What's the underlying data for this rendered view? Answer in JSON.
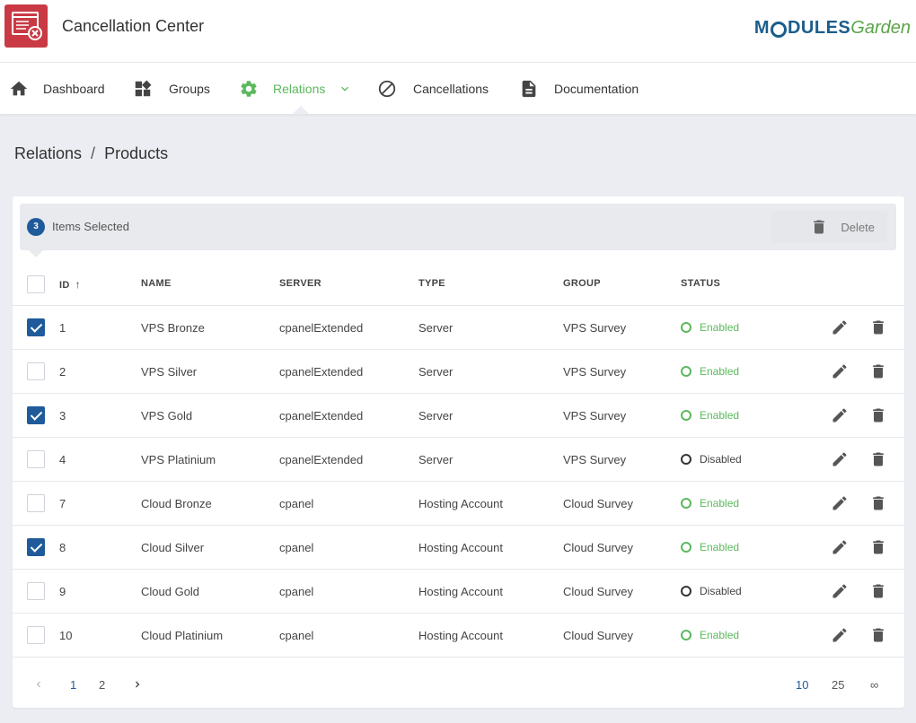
{
  "header": {
    "title": "Cancellation Center",
    "brand_left": "M",
    "brand_mid": "DULES",
    "brand_right": "Garden",
    "accent_color": "#c93a45"
  },
  "nav": {
    "items": [
      {
        "label": "Dashboard",
        "icon": "home-icon"
      },
      {
        "label": "Groups",
        "icon": "widgets-icon"
      },
      {
        "label": "Relations",
        "icon": "gear-icon",
        "active": true
      },
      {
        "label": "Cancellations",
        "icon": "block-icon"
      },
      {
        "label": "Documentation",
        "icon": "document-icon"
      }
    ],
    "active_color": "#5cb85c"
  },
  "breadcrumb": {
    "parent": "Relations",
    "separator": "/",
    "current": "Products"
  },
  "selection": {
    "count": "3",
    "label": "Items Selected",
    "delete_label": "Delete"
  },
  "table": {
    "columns": [
      "ID",
      "NAME",
      "SERVER",
      "TYPE",
      "GROUP",
      "STATUS"
    ],
    "sort_indicator": "↑",
    "rows": [
      {
        "checked": true,
        "id": "1",
        "name": "VPS Bronze",
        "server": "cpanelExtended",
        "type": "Server",
        "group": "VPS Survey",
        "status": "Enabled"
      },
      {
        "checked": false,
        "id": "2",
        "name": "VPS Silver",
        "server": "cpanelExtended",
        "type": "Server",
        "group": "VPS Survey",
        "status": "Enabled"
      },
      {
        "checked": true,
        "id": "3",
        "name": "VPS Gold",
        "server": "cpanelExtended",
        "type": "Server",
        "group": "VPS Survey",
        "status": "Enabled"
      },
      {
        "checked": false,
        "id": "4",
        "name": "VPS Platinium",
        "server": "cpanelExtended",
        "type": "Server",
        "group": "VPS Survey",
        "status": "Disabled"
      },
      {
        "checked": false,
        "id": "7",
        "name": "Cloud Bronze",
        "server": "cpanel",
        "type": "Hosting Account",
        "group": "Cloud Survey",
        "status": "Enabled"
      },
      {
        "checked": true,
        "id": "8",
        "name": "Cloud Silver",
        "server": "cpanel",
        "type": "Hosting Account",
        "group": "Cloud Survey",
        "status": "Enabled"
      },
      {
        "checked": false,
        "id": "9",
        "name": "Cloud Gold",
        "server": "cpanel",
        "type": "Hosting Account",
        "group": "Cloud Survey",
        "status": "Disabled"
      },
      {
        "checked": false,
        "id": "10",
        "name": "Cloud Platinium",
        "server": "cpanel",
        "type": "Hosting Account",
        "group": "Cloud Survey",
        "status": "Enabled"
      }
    ],
    "status_colors": {
      "enabled": "#5cb85c",
      "disabled": "#333333"
    }
  },
  "pagination": {
    "pages": [
      "1",
      "2"
    ],
    "current_page": "1",
    "page_sizes": [
      "10",
      "25",
      "∞"
    ],
    "current_size": "10",
    "active_color": "#1f5b9b"
  }
}
